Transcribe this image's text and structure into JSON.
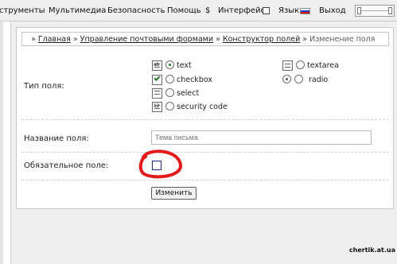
{
  "menu": {
    "items": [
      "струменты",
      "Мультимедиа",
      "Безопасность",
      "Помощь",
      "$",
      "Интерфейс",
      "Язык",
      "Выход"
    ]
  },
  "breadcrumb": {
    "links": [
      "Главная",
      "Управление почтовыми формами",
      "Конструктор полей"
    ],
    "current": "Изменение поля"
  },
  "form": {
    "field_type_label": "Тип поля:",
    "options": [
      {
        "label": "text",
        "selected": true,
        "icon": "text-field-icon"
      },
      {
        "label": "checkbox",
        "selected": false,
        "icon": "checkbox-icon"
      },
      {
        "label": "select",
        "selected": false,
        "icon": "select-icon"
      },
      {
        "label": "security code",
        "selected": false,
        "icon": "security-code-icon"
      },
      {
        "label": "textarea",
        "selected": false,
        "icon": "textarea-icon"
      },
      {
        "label": "radio",
        "selected": true,
        "icon": "radio-icon"
      }
    ],
    "field_name_label": "Название поля:",
    "field_name_value": "Тема письма",
    "required_label": "Обязательное поле:",
    "required_checked": false,
    "submit_label": "Изменить"
  },
  "watermark": "chertik.at.ua",
  "colors": {
    "accent_green": "#1f7f35",
    "annotation_red": "#e31b1b"
  }
}
